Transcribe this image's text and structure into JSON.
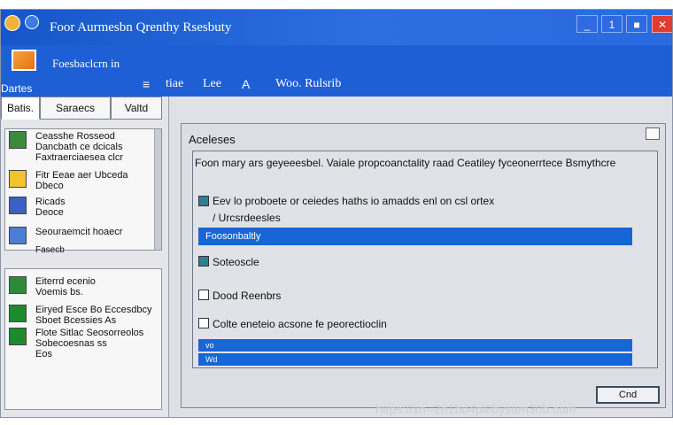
{
  "window": {
    "title": "Foor   Aurmesbn Qrenthy Rsesbuty",
    "controls": [
      "_",
      "1",
      "■",
      "✕"
    ]
  },
  "header": {
    "subtitle": "Foesbaclcrn  in",
    "left_label": "Dartes",
    "items": [
      "tiae",
      "Lee",
      "Woo. Rulsrib"
    ]
  },
  "sidebar": {
    "tabs": [
      "Batis.",
      "Saraecs",
      "Valtd"
    ],
    "panel1_items": [
      {
        "lines": [
          "Ceasshe  Rosseod",
          "Dancbath ce dcicals",
          "Faxtraerciaesea  clcr"
        ]
      },
      {
        "lines": [
          "Fitr Eeae  aer  Ubceda",
          "Dbeco"
        ]
      },
      {
        "lines": [
          "Ricads",
          "Deoce"
        ]
      },
      {
        "lines": [
          "Seouraemcit hoaecr"
        ]
      },
      {
        "lines": [
          "Fasecb"
        ]
      }
    ],
    "panel2_items": [
      {
        "lines": [
          "Eiterrd  ecenio",
          "Voemis  bs."
        ]
      },
      {
        "lines": [
          "Eiryed Esce Bo Eccesdbcy",
          "Sboet  Bcessies  As"
        ]
      },
      {
        "lines": [
          "Flote Sitlac Seosorreolos",
          "Sobecoesnas  ss",
          "Eos"
        ]
      }
    ]
  },
  "dialog": {
    "title": "Aceleses",
    "description": "Foon mary ars geyeeesbel. Vaiale propcoanctality raad Ceatiley fyceonerrtece Bsmythcre",
    "options": [
      {
        "label": "Eev lo proboete or ceiedes  haths io amadds  enl on csl  ortex",
        "checked": true
      },
      {
        "label": "/ Urcsrdeesles",
        "checked": false
      },
      {
        "label": "Soteoscle",
        "checked": true
      },
      {
        "label": "Dood  Reenbrs",
        "checked": false
      },
      {
        "label": "Colte  eneteio  acsone fe  peorectioclin",
        "checked": false
      }
    ],
    "highlight_bar": "Foosonbaltly",
    "thin_bars": [
      "vo",
      "Wd"
    ],
    "cancel_label": "Cnd"
  },
  "watermark": "https://xn--2n1bo4pi8bysam30b.com",
  "colors": {
    "accent": "#1f5fd6",
    "bar": "#1766d6",
    "close": "#e23b2f"
  }
}
